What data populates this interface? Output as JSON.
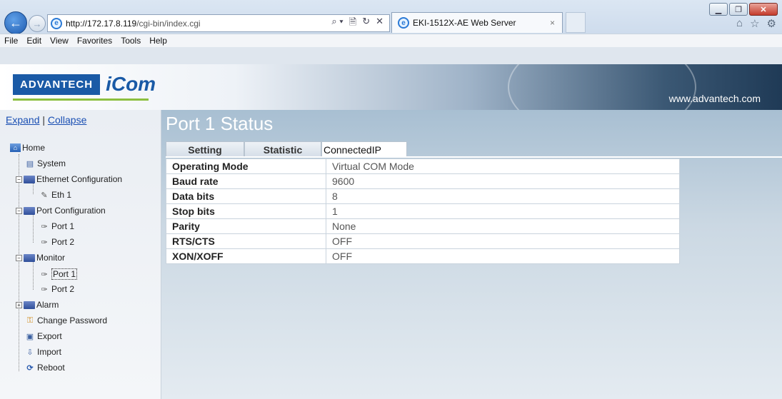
{
  "browser": {
    "url_host": "http://172.17.8.119",
    "url_path": "/cgi-bin/index.cgi",
    "tab_title": "EKI-1512X-AE Web Server",
    "tab_close": "×",
    "menu": [
      "File",
      "Edit",
      "View",
      "Favorites",
      "Tools",
      "Help"
    ],
    "address_tools": [
      "⌕ ▾",
      "🗎",
      "↻",
      "✕"
    ],
    "right_icons": [
      "⌂",
      "☆",
      "⚙"
    ]
  },
  "header": {
    "logo_text": "ADVANTECH",
    "logo_product": "iCom",
    "site_url": "www.advantech.com"
  },
  "sidebar": {
    "expand_label": "Expand",
    "separator": "|",
    "collapse_label": "Collapse",
    "tree": {
      "home": "Home",
      "system": "System",
      "ethernet_configuration": "Ethernet Configuration",
      "eth1": "Eth 1",
      "port_configuration": "Port Configuration",
      "port_config_port1": "Port 1",
      "port_config_port2": "Port 2",
      "monitor": "Monitor",
      "monitor_port1": "Port 1",
      "monitor_port2": "Port 2",
      "alarm": "Alarm",
      "change_password": "Change Password",
      "export": "Export",
      "import": "Import",
      "reboot": "Reboot"
    }
  },
  "main": {
    "title": "Port 1 Status",
    "tabs": [
      "Setting",
      "Statistic",
      "ConnectedIP"
    ],
    "rows": [
      {
        "key": "Operating Mode",
        "value": "Virtual COM Mode"
      },
      {
        "key": "Baud rate",
        "value": "9600"
      },
      {
        "key": "Data bits",
        "value": "8"
      },
      {
        "key": "Stop bits",
        "value": "1"
      },
      {
        "key": "Parity",
        "value": "None"
      },
      {
        "key": "RTS/CTS",
        "value": "OFF"
      },
      {
        "key": "XON/XOFF",
        "value": "OFF"
      }
    ]
  },
  "colors": {
    "link": "#1a4fb3",
    "brand_blue": "#1a5aa6",
    "brand_green": "#8cbf3f"
  }
}
